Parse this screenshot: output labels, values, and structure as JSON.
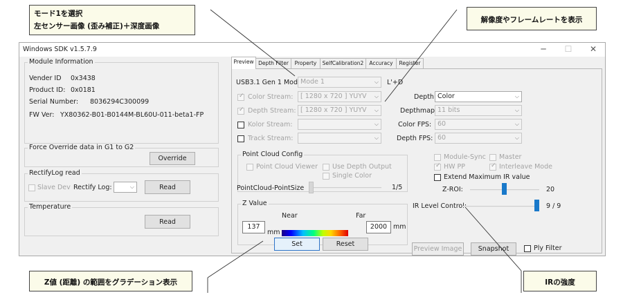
{
  "callouts": {
    "mode_line1": "モード1を選択",
    "mode_line2": "左センサー画像 (歪み補正)＋深度画像",
    "resolution": "解像度やフレームレートを表示",
    "zvalue": "Z値 (距離) の範囲をグラデーション表示",
    "ir": "IRの強度"
  },
  "window": {
    "title": "Windows SDK v1.5.7.9",
    "minimize": "─",
    "maximize": "☐",
    "close": "✕"
  },
  "module_info": {
    "title": "Module Information",
    "vender_label": "Vender ID",
    "vender_value": "0x3438",
    "product_label": "Product ID:",
    "product_value": "0x0181",
    "serial_label": "Serial Number:",
    "serial_value": "8036294C300099",
    "fw_label": "FW Ver:",
    "fw_value": "YX80362-B01-B0144M-BL60U-011-beta1-FP"
  },
  "force_override": {
    "title": "Force Override data in G1 to G2",
    "button": "Override"
  },
  "rectify": {
    "title": "RectifyLog read",
    "slave_dev": "Slave Dev",
    "log_label": "Rectify Log:",
    "log_value": "",
    "read_button": "Read"
  },
  "temperature": {
    "title": "Temperature",
    "read_button": "Read"
  },
  "tabs": [
    "Preview",
    "Depth Filter",
    "Property",
    "SelfCalibration2",
    "Accuracy",
    "Register"
  ],
  "preview": {
    "usb_label": "USB3.1 Gen 1 Mode:",
    "usb_mode": "Mode 1",
    "mode_desc": "L'+D",
    "color_stream_label": "Color Stream:",
    "color_stream_value": "[ 1280 x  720 ] YUYV",
    "depth_stream_label": "Depth Stream:",
    "depth_stream_value": "[ 1280 x  720 ] YUYV",
    "kolor_stream_label": "Kolor Stream:",
    "track_stream_label": "Track Stream:",
    "depth_label": "Depth",
    "depth_value": "Color",
    "depthmap_label": "Depthmap",
    "depthmap_value": "11 bits",
    "color_fps_label": "Color FPS:",
    "color_fps_value": "60",
    "depth_fps_label": "Depth FPS:",
    "depth_fps_value": "60",
    "point_cloud": {
      "title": "Point Cloud Config",
      "viewer": "Point Cloud Viewer",
      "use_depth": "Use Depth Output",
      "single_color": "Single Color",
      "size_label": "PointCloud-PointSize",
      "size_value": "1/5"
    },
    "z_value": {
      "title": "Z Value",
      "near_label": "Near",
      "far_label": "Far",
      "near_value": "137",
      "far_value": "2000",
      "unit": "mm",
      "set_button": "Set",
      "reset_button": "Reset"
    },
    "module_sync": "Module-Sync",
    "master": "Master",
    "hw_pp": "HW PP",
    "interleave": "Interleave Mode",
    "extend_ir": "Extend Maximum IR value",
    "zroi_label": "Z-ROI:",
    "zroi_value": "20",
    "ir_label": "IR Level Control:",
    "ir_value": "9 / 9",
    "ir_level": 9,
    "ir_max": 9,
    "preview_image": "Preview Image",
    "snapshot": "Snapshot",
    "ply_filter": "Ply Filter"
  }
}
